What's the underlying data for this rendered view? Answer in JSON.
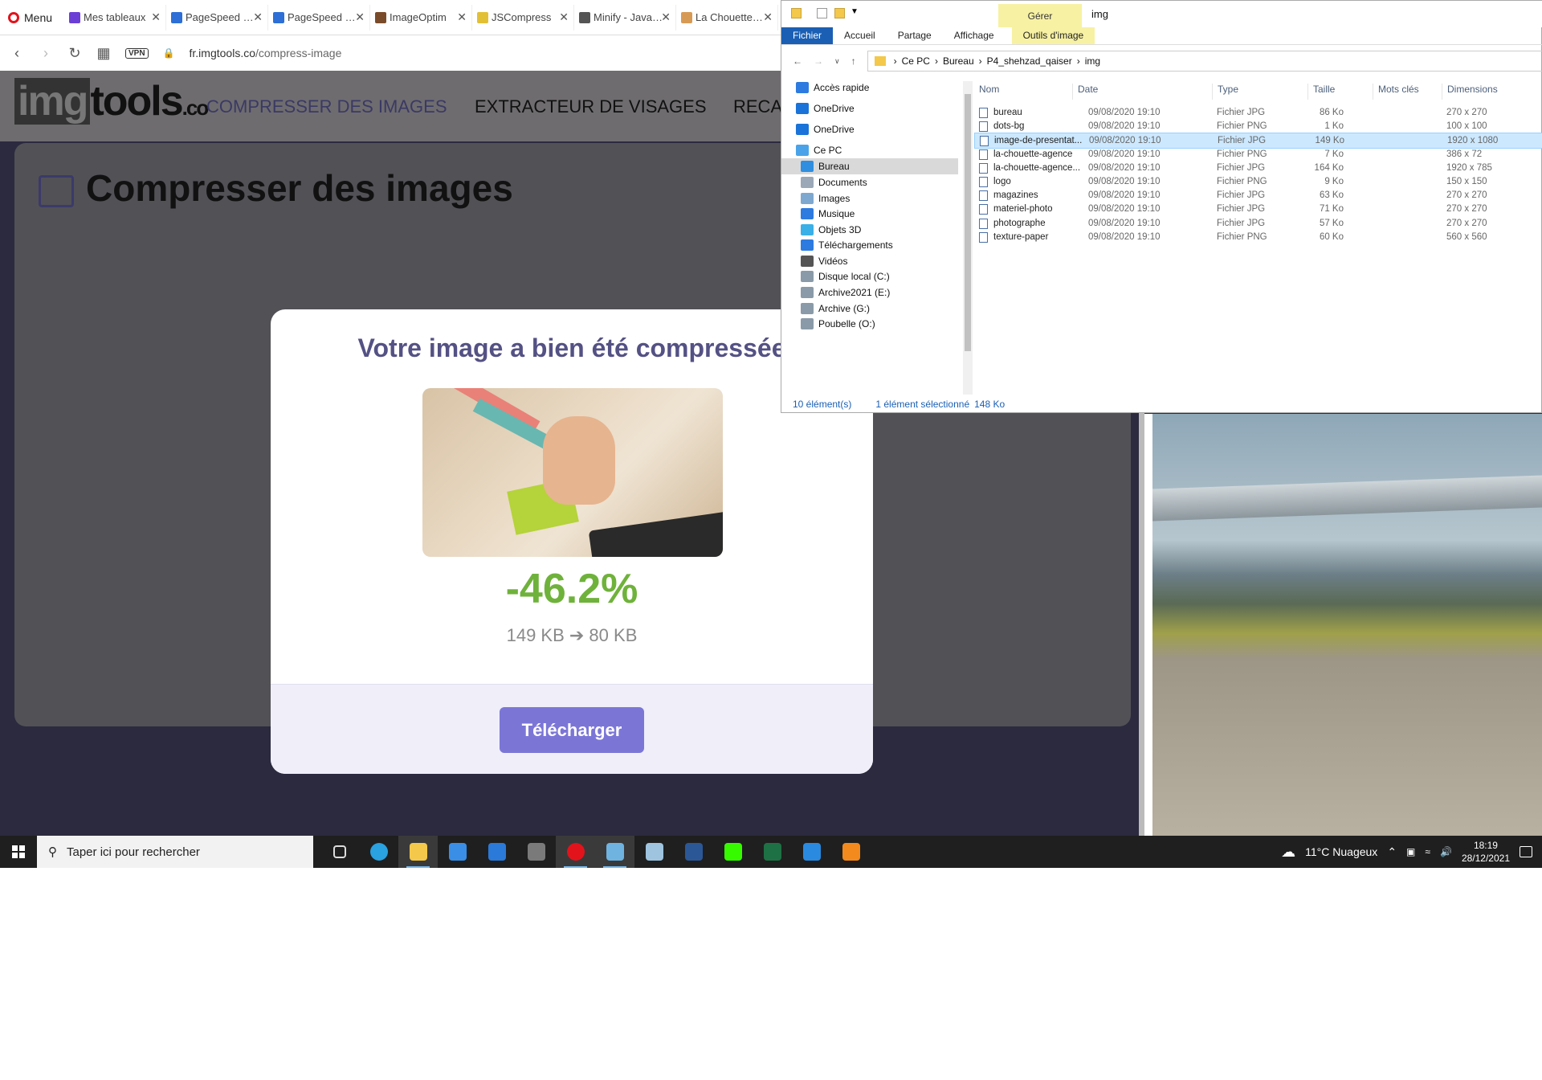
{
  "browser": {
    "menu_label": "Menu",
    "tabs": [
      {
        "label": "Mes tableaux",
        "color": "#6b3fd6"
      },
      {
        "label": "PageSpeed Insights",
        "color": "#2d6fd6"
      },
      {
        "label": "PageSpeed Insights",
        "color": "#2d6fd6"
      },
      {
        "label": "ImageOptim",
        "color": "#7a4b2a"
      },
      {
        "label": "JSCompress",
        "color": "#e2c036"
      },
      {
        "label": "Minify - JavaScript",
        "color": "#555555"
      },
      {
        "label": "La Chouette Agence",
        "color": "#d79a55"
      }
    ],
    "vpn_label": "VPN",
    "url_host": "fr.imgtools.co",
    "url_path": "/compress-image"
  },
  "site": {
    "logo_img": "img",
    "logo_tools": "tools",
    "logo_co": ".co",
    "nav": [
      "COMPRESSER DES IMAGES",
      "EXTRACTEUR DE VISAGES",
      "RECA"
    ],
    "card_title": "Compresser des images"
  },
  "modal": {
    "title": "Votre image a bien été compressée",
    "percent": "-46.2%",
    "sizes": "149 KB ➔ 80 KB",
    "download_label": "Télécharger"
  },
  "explorer": {
    "window_title": "img",
    "gerer_label": "Gérer",
    "ribbon_tabs": [
      "Fichier",
      "Accueil",
      "Partage",
      "Affichage",
      "Outils d'image"
    ],
    "breadcrumb": [
      "Ce PC",
      "Bureau",
      "P4_shehzad_qaiser",
      "img"
    ],
    "nav_items": [
      {
        "label": "Accès rapide",
        "icon": "star-icon",
        "color": "#2d7be0"
      },
      {
        "label": "OneDrive",
        "icon": "cloud-icon",
        "color": "#1a73d8"
      },
      {
        "label": "OneDrive",
        "icon": "cloud-icon",
        "color": "#1a73d8"
      },
      {
        "label": "Ce PC",
        "icon": "computer-icon",
        "color": "#4aa3e8"
      },
      {
        "label": "Bureau",
        "icon": "desktop-icon",
        "color": "#2f8ee0"
      },
      {
        "label": "Documents",
        "icon": "document-icon",
        "color": "#9aa8b8"
      },
      {
        "label": "Images",
        "icon": "image-icon",
        "color": "#7fa8d0"
      },
      {
        "label": "Musique",
        "icon": "music-icon",
        "color": "#2d7be0"
      },
      {
        "label": "Objets 3D",
        "icon": "cube-icon",
        "color": "#3ab0e8"
      },
      {
        "label": "Téléchargements",
        "icon": "download-icon",
        "color": "#2d7be0"
      },
      {
        "label": "Vidéos",
        "icon": "video-icon",
        "color": "#555555"
      },
      {
        "label": "Disque local (C:)",
        "icon": "drive-icon",
        "color": "#8a9aa8"
      },
      {
        "label": "Archive2021 (E:)",
        "icon": "drive-icon",
        "color": "#8a9aa8"
      },
      {
        "label": "Archive (G:)",
        "icon": "drive-icon",
        "color": "#8a9aa8"
      },
      {
        "label": "Poubelle (O:)",
        "icon": "drive-icon",
        "color": "#8a9aa8"
      }
    ],
    "columns": [
      "Nom",
      "Date",
      "Type",
      "Taille",
      "Mots clés",
      "Dimensions"
    ],
    "files": [
      {
        "name": "bureau",
        "date": "09/08/2020 19:10",
        "type": "Fichier JPG",
        "size": "86 Ko",
        "dims": "270 x 270"
      },
      {
        "name": "dots-bg",
        "date": "09/08/2020 19:10",
        "type": "Fichier PNG",
        "size": "1 Ko",
        "dims": "100 x 100"
      },
      {
        "name": "image-de-presentat...",
        "date": "09/08/2020 19:10",
        "type": "Fichier JPG",
        "size": "149 Ko",
        "dims": "1920 x 1080"
      },
      {
        "name": "la-chouette-agence",
        "date": "09/08/2020 19:10",
        "type": "Fichier PNG",
        "size": "7 Ko",
        "dims": "386 x 72"
      },
      {
        "name": "la-chouette-agence...",
        "date": "09/08/2020 19:10",
        "type": "Fichier JPG",
        "size": "164 Ko",
        "dims": "1920 x 785"
      },
      {
        "name": "logo",
        "date": "09/08/2020 19:10",
        "type": "Fichier PNG",
        "size": "9 Ko",
        "dims": "150 x 150"
      },
      {
        "name": "magazines",
        "date": "09/08/2020 19:10",
        "type": "Fichier JPG",
        "size": "63 Ko",
        "dims": "270 x 270"
      },
      {
        "name": "materiel-photo",
        "date": "09/08/2020 19:10",
        "type": "Fichier JPG",
        "size": "71 Ko",
        "dims": "270 x 270"
      },
      {
        "name": "photographe",
        "date": "09/08/2020 19:10",
        "type": "Fichier JPG",
        "size": "57 Ko",
        "dims": "270 x 270"
      },
      {
        "name": "texture-paper",
        "date": "09/08/2020 19:10",
        "type": "Fichier PNG",
        "size": "60 Ko",
        "dims": "560 x 560"
      }
    ],
    "status_count": "10 élément(s)",
    "status_selected": "1 élément sélectionné",
    "status_size": "148 Ko"
  },
  "taskbar": {
    "search_placeholder": "Taper ici pour rechercher",
    "apps": [
      {
        "name": "task-view-icon",
        "color": "#dddddd"
      },
      {
        "name": "edge-icon",
        "color": "#2aa1e0"
      },
      {
        "name": "file-explorer-icon",
        "color": "#f3c84b"
      },
      {
        "name": "store-icon",
        "color": "#3a8ee6"
      },
      {
        "name": "mail-icon",
        "color": "#2b79d8"
      },
      {
        "name": "calculator-icon",
        "color": "#7a7a7a"
      },
      {
        "name": "opera-icon",
        "color": "#e3131b"
      },
      {
        "name": "paint-icon",
        "color": "#6fb3e0"
      },
      {
        "name": "notes-icon",
        "color": "#9ec4e0"
      },
      {
        "name": "word-icon",
        "color": "#2b5797"
      },
      {
        "name": "dreamweaver-icon",
        "color": "#35fa00"
      },
      {
        "name": "excel-icon",
        "color": "#1e7145"
      },
      {
        "name": "vscode-icon",
        "color": "#2a8ae0"
      },
      {
        "name": "sublime-icon",
        "color": "#f28a1e"
      }
    ],
    "weather": "11°C  Nuageux",
    "time": "18:19",
    "date": "28/12/2021"
  }
}
